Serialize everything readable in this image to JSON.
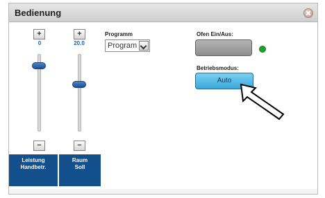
{
  "window": {
    "title": "Bedienung"
  },
  "slider_left": {
    "plus": "+",
    "minus": "−",
    "value": "0",
    "label_line1": "Leistung",
    "label_line2": "Handbetr.",
    "level": 0.88
  },
  "slider_right": {
    "plus": "+",
    "minus": "−",
    "value": "20.0",
    "label_line1": "Raum",
    "label_line2": "Soll",
    "level": 0.62
  },
  "programm": {
    "label": "Programm",
    "selected": "Program"
  },
  "ofen": {
    "label": "Ofen Ein/Aus:",
    "led_color": "#1fa32c"
  },
  "betriebsmodus": {
    "label": "Betriebsmodus:",
    "button": "Auto"
  },
  "colors": {
    "accent_blue": "#134f8b",
    "auto_button": "#4fb8e6"
  }
}
